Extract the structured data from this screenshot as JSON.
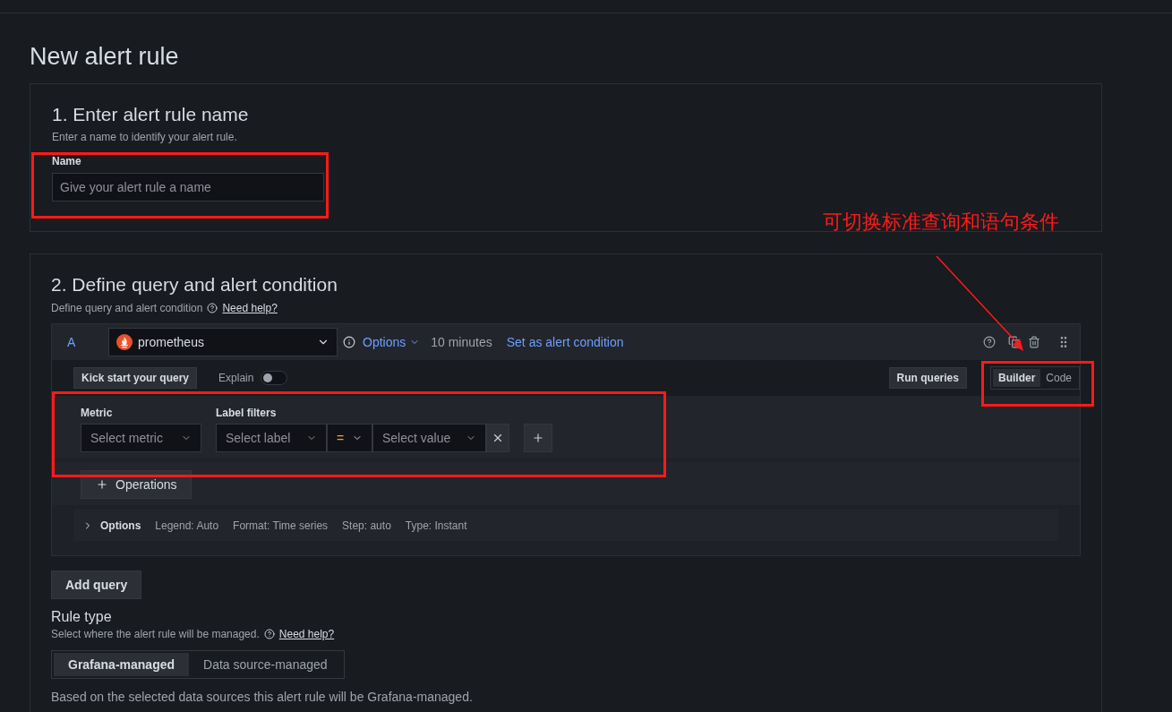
{
  "page_title": "New alert rule",
  "name_section": {
    "title": "1. Enter alert rule name",
    "description": "Enter a name to identify your alert rule.",
    "field_label": "Name",
    "placeholder": "Give your alert rule a name"
  },
  "query_section": {
    "title": "2. Define query and alert condition",
    "description": "Define query and alert condition",
    "help_link": "Need help?",
    "query": {
      "ref": "A",
      "datasource": "prometheus",
      "options": "Options",
      "interval": "10 minutes",
      "set_condition": "Set as alert condition",
      "kick_start": "Kick start your query",
      "explain": {
        "label": "Explain",
        "on": false
      },
      "run": "Run queries",
      "modes": [
        {
          "label": "Builder",
          "selected": true
        },
        {
          "label": "Code",
          "selected": false
        }
      ],
      "metric": {
        "label": "Metric",
        "placeholder": "Select metric"
      },
      "label_filters": {
        "label": "Label filters",
        "label_placeholder": "Select label",
        "operator": "=",
        "value_placeholder": "Select value"
      },
      "operations": "Operations",
      "options_row": {
        "label": "Options",
        "items": [
          "Legend: Auto",
          "Format: Time series",
          "Step: auto",
          "Type: Instant"
        ]
      }
    },
    "add_query": "Add query",
    "rule_type": {
      "title": "Rule type",
      "description": "Select where the alert rule will be managed.",
      "help_link": "Need help?",
      "tabs": [
        {
          "label": "Grafana-managed",
          "selected": true
        },
        {
          "label": "Data source-managed",
          "selected": false
        }
      ],
      "note": "Based on the selected data sources this alert rule will be Grafana-managed."
    }
  },
  "annotation": {
    "text": "可切换标准查询和语句条件"
  }
}
